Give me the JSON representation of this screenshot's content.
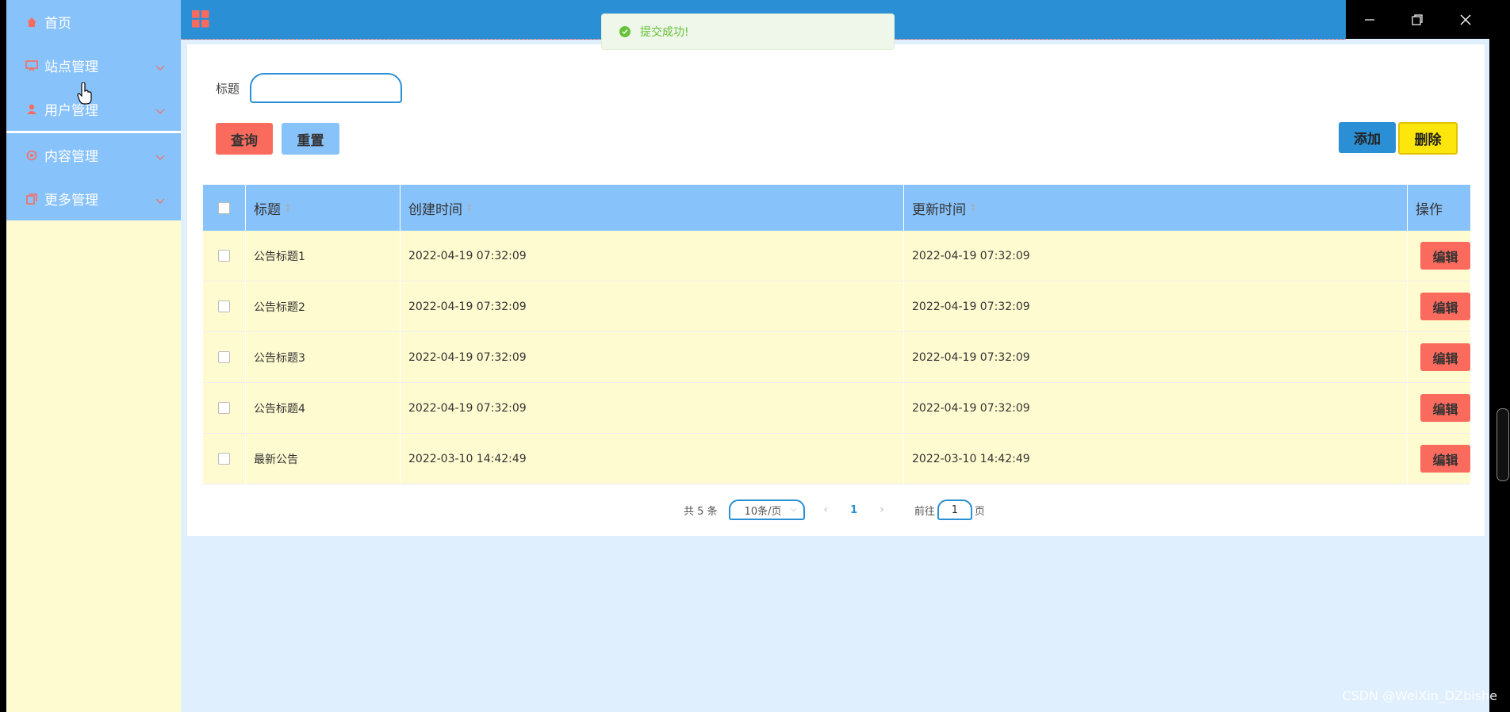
{
  "sidebar": {
    "items": [
      {
        "label": "首页",
        "icon": "home-icon",
        "has_submenu": false
      },
      {
        "label": "站点管理",
        "icon": "site-icon",
        "has_submenu": true
      },
      {
        "label": "用户管理",
        "icon": "user-icon",
        "has_submenu": true
      },
      {
        "label": "内容管理",
        "icon": "content-icon",
        "has_submenu": true
      },
      {
        "label": "更多管理",
        "icon": "more-icon",
        "has_submenu": true
      }
    ]
  },
  "topbar": {
    "menu_icon": "grid-icon"
  },
  "window_controls": [
    "minimize-icon",
    "restore-icon",
    "close-icon"
  ],
  "toast": {
    "message": "提交成功!",
    "type": "success"
  },
  "search": {
    "label": "标题",
    "value": "",
    "placeholder": ""
  },
  "buttons": {
    "query": "查询",
    "reset": "重置",
    "add": "添加",
    "delete": "删除"
  },
  "table": {
    "columns": [
      "标题",
      "创建时间",
      "更新时间",
      "操作"
    ],
    "rows": [
      {
        "title": "公告标题1",
        "created": "2022-04-19 07:32:09",
        "updated": "2022-04-19 07:32:09",
        "action": "编辑"
      },
      {
        "title": "公告标题2",
        "created": "2022-04-19 07:32:09",
        "updated": "2022-04-19 07:32:09",
        "action": "编辑"
      },
      {
        "title": "公告标题3",
        "created": "2022-04-19 07:32:09",
        "updated": "2022-04-19 07:32:09",
        "action": "编辑"
      },
      {
        "title": "公告标题4",
        "created": "2022-04-19 07:32:09",
        "updated": "2022-04-19 07:32:09",
        "action": "编辑"
      },
      {
        "title": "最新公告",
        "created": "2022-03-10 14:42:49",
        "updated": "2022-03-10 14:42:49",
        "action": "编辑"
      }
    ]
  },
  "pagination": {
    "total": "共 5 条",
    "page_size": "10条/页",
    "current_page": "1",
    "goto_label": "前往",
    "goto_value": "1",
    "page_suffix": "页"
  },
  "watermark": "CSDN @WeiXin_DZbishe",
  "colors": {
    "primary": "#2a8fd4",
    "sidebar": "#88c2fb",
    "row_bg": "#fffbd0",
    "danger": "#fa6b5d",
    "warning": "#fde60b",
    "success": "#67c23a"
  }
}
